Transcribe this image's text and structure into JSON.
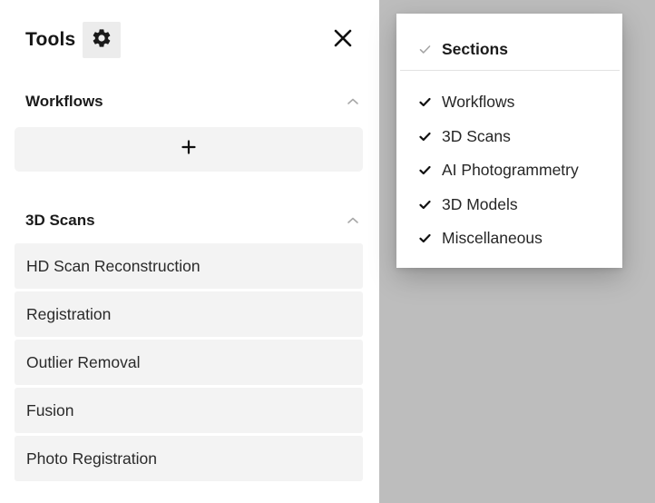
{
  "panel": {
    "title": "Tools",
    "settings_icon": "gear-icon",
    "close_icon": "close-icon"
  },
  "sections": {
    "workflows": {
      "title": "Workflows",
      "chevron_icon": "chevron-up-icon",
      "add_label": "+"
    },
    "scans": {
      "title": "3D Scans",
      "chevron_icon": "chevron-up-icon",
      "items": [
        {
          "label": "HD Scan Reconstruction"
        },
        {
          "label": "Registration"
        },
        {
          "label": "Outlier Removal"
        },
        {
          "label": "Fusion"
        },
        {
          "label": "Photo Registration"
        }
      ]
    }
  },
  "dropdown": {
    "title": "Sections",
    "header_checked": true,
    "items": [
      {
        "label": "Workflows",
        "checked": true
      },
      {
        "label": "3D Scans",
        "checked": true
      },
      {
        "label": "AI Photogrammetry",
        "checked": true
      },
      {
        "label": "3D Models",
        "checked": true
      },
      {
        "label": "Miscellaneous",
        "checked": true
      }
    ]
  },
  "colors": {
    "panel_bg": "#ffffff",
    "canvas_bg": "#bdbdbd",
    "item_bg": "#f3f3f3",
    "gear_button_bg": "#ececec",
    "text": "#1d1d1d",
    "header_check": "#a5a5a5"
  }
}
